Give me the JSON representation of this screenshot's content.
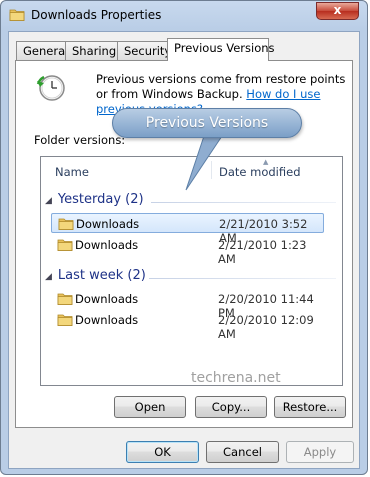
{
  "window": {
    "title": "Downloads Properties",
    "close_label": "x"
  },
  "tabs": [
    {
      "label": "General"
    },
    {
      "label": "Sharing"
    },
    {
      "label": "Security"
    },
    {
      "label": "Previous Versions",
      "active": true
    }
  ],
  "intro": {
    "text": "Previous versions come from restore points or from Windows Backup.",
    "link": "How do I use previous versions?"
  },
  "folder_versions_label": "Folder versions:",
  "columns": {
    "name": "Name",
    "date_modified": "Date modified"
  },
  "groups": [
    {
      "label": "Yesterday (2)",
      "items": [
        {
          "name": "Downloads",
          "date": "2/21/2010 3:52 AM",
          "selected": true
        },
        {
          "name": "Downloads",
          "date": "2/21/2010 1:23 AM"
        }
      ]
    },
    {
      "label": "Last week (2)",
      "items": [
        {
          "name": "Downloads",
          "date": "2/20/2010 11:44 PM"
        },
        {
          "name": "Downloads",
          "date": "2/20/2010 12:09 AM"
        }
      ]
    }
  ],
  "watermark": "techrena.net",
  "action_buttons": {
    "open": "Open",
    "copy": "Copy...",
    "restore": "Restore..."
  },
  "dialog_buttons": {
    "ok": "OK",
    "cancel": "Cancel",
    "apply": "Apply"
  },
  "callout": "Previous Versions",
  "colors": {
    "link": "#0066cc",
    "group_header": "#1e3287",
    "selection": "#d4e6fb"
  }
}
